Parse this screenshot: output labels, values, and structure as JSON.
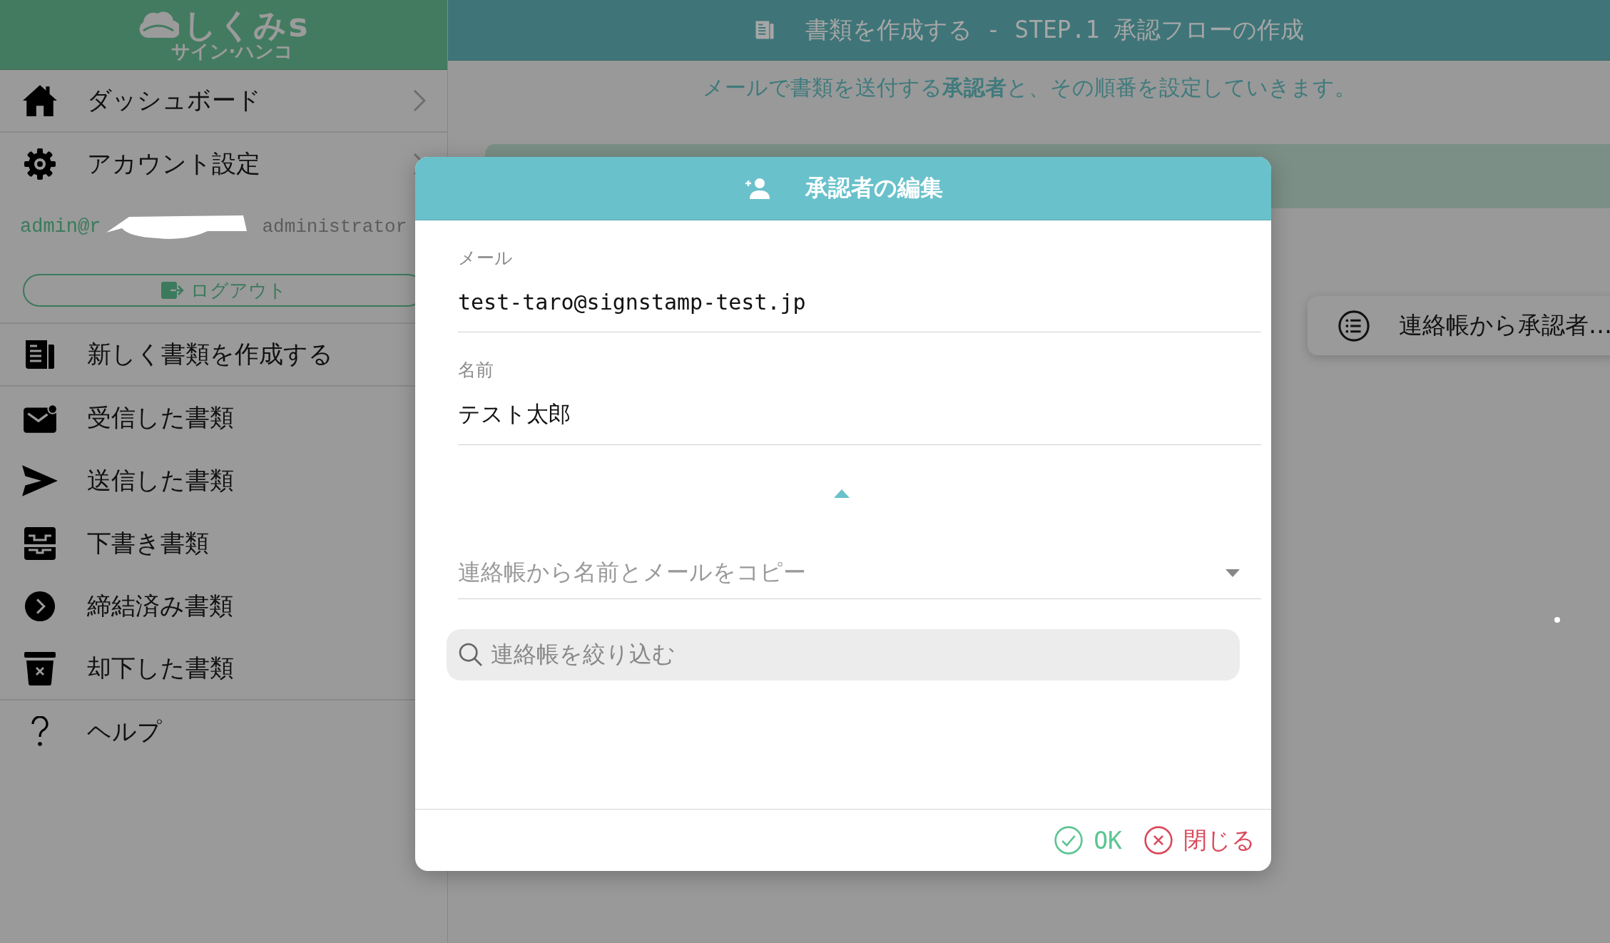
{
  "sidebar": {
    "logo": {
      "title": "しくみs",
      "subtitle": "サイン·ハンコ"
    },
    "top_items": [
      {
        "kind": "home",
        "label": "ダッシュボード",
        "chevron": true
      },
      {
        "kind": "gear",
        "label": "アカウント設定",
        "chevron": true
      }
    ],
    "user": {
      "email": "admin@r",
      "role": "administrator"
    },
    "logout_button": "ログアウト",
    "items": [
      {
        "kind": "document",
        "label": "新しく書類を作成する"
      },
      {
        "kind": "mail",
        "label": "受信した書類"
      },
      {
        "kind": "send",
        "label": "送信した書類"
      },
      {
        "kind": "tray",
        "label": "下書き書類"
      },
      {
        "kind": "circle-chevron",
        "label": "締結済み書類"
      },
      {
        "kind": "trash",
        "label": "却下した書類"
      }
    ],
    "help_item": {
      "kind": "help",
      "label": "ヘルプ"
    }
  },
  "header": {
    "title": "書類を作成する - STEP.1 承認フローの作成",
    "subtitle": "メールで書類を送付する**承認者**と、その順番を設定していきます。"
  },
  "contact_button": "連絡帳から承認者…",
  "dialog": {
    "title": "承認者の編集",
    "fields": [
      {
        "label": "メール",
        "value": "test-taro@signstamp-test.jp"
      },
      {
        "label": "名前",
        "value": "テスト太郎"
      }
    ],
    "section_expanded": true,
    "contact_select": {
      "placeholder": "連絡帳から名前とメールをコピー"
    },
    "filter": {
      "placeholder": "連絡帳を絞り込む"
    },
    "buttons": [
      {
        "kind": "ok",
        "label": "OK"
      },
      {
        "kind": "close",
        "label": "閉じる"
      }
    ]
  }
}
